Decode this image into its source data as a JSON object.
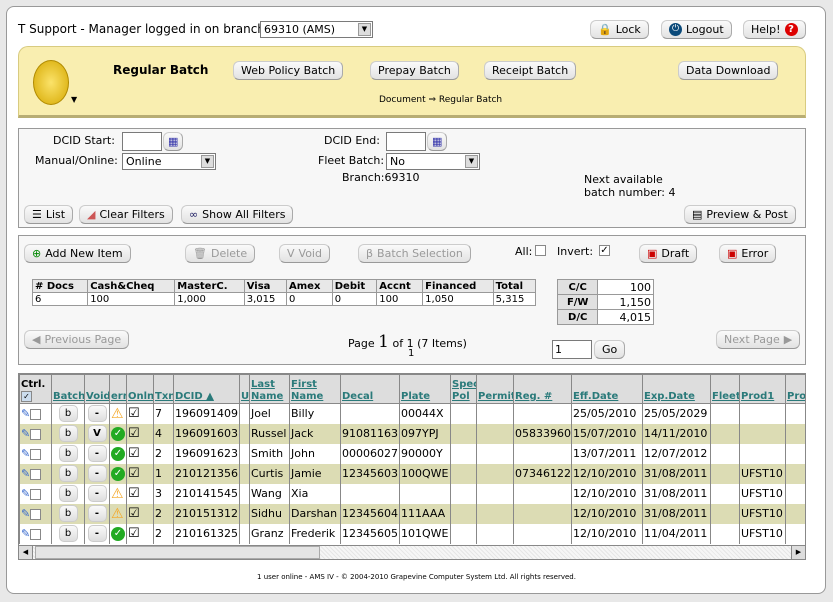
{
  "header": {
    "login_text": "T Support - Manager logged in on branch:",
    "branch_select": "69310 (AMS)",
    "lock": "Lock",
    "logout": "Logout",
    "help": "Help!"
  },
  "banner": {
    "active": "Regular Batch",
    "tabs": [
      "Web Policy Batch",
      "Prepay Batch",
      "Receipt Batch",
      "Data Download"
    ],
    "breadcrumb": "Document ⇒ Regular Batch"
  },
  "filters": {
    "dcid_start_label": "DCID Start:",
    "dcid_start": "",
    "dcid_end_label": "DCID End:",
    "dcid_end": "",
    "manual_online_label": "Manual/Online:",
    "manual_online": "Online",
    "fleet_batch_label": "Fleet Batch:",
    "fleet_batch": "No",
    "branch": "Branch:69310",
    "next_batch_1": "Next available",
    "next_batch_2": "batch number: 4",
    "list": "List",
    "clear": "Clear Filters",
    "show_all": "Show All Filters",
    "preview_post": "Preview & Post"
  },
  "actions": {
    "add": "Add New Item",
    "delete": "Delete",
    "void": "Void",
    "batch_selection": "Batch Selection",
    "all_label": "All:",
    "all_checked": false,
    "invert_label": "Invert:",
    "invert_checked": true,
    "draft": "Draft",
    "error": "Error"
  },
  "summary": {
    "headers": [
      "# Docs",
      "Cash&Cheq",
      "MasterC.",
      "Visa",
      "Amex",
      "Debit",
      "Accnt",
      "Financed",
      "Total"
    ],
    "values": [
      "6",
      "100",
      "1,000",
      "3,015",
      "0",
      "0",
      "100",
      "1,050",
      "5,315"
    ]
  },
  "card_totals": [
    {
      "k": "C/C",
      "v": "100"
    },
    {
      "k": "F/W",
      "v": "1,150"
    },
    {
      "k": "D/C",
      "v": "4,015"
    }
  ],
  "paging": {
    "prev": "Previous Page",
    "next": "Next Page",
    "page_prefix": "Page",
    "page_num": "1",
    "page_suffix": "of 1 (7 Items)",
    "page_links": "1",
    "goto_value": "1",
    "go": "Go"
  },
  "grid": {
    "columns": [
      "Ctrl.",
      "Batch",
      "Void",
      "err",
      "Onln",
      "Txn",
      "DCID ▲",
      "U",
      "Last Name",
      "First Name",
      "Decal",
      "Plate",
      "Spec Pol",
      "Permit",
      "Reg. #",
      "Eff.Date",
      "Exp.Date",
      "Fleet",
      "Prod1",
      "Prod"
    ],
    "rows": [
      {
        "batch": "b",
        "void": "-",
        "err": "warning",
        "txn": "7",
        "dcid": "196091409",
        "u": "",
        "last": "Joel",
        "first": "Billy",
        "decal": "",
        "plate": "00044X",
        "spec": "",
        "permit": "",
        "reg": "",
        "eff": "25/05/2010",
        "exp": "25/05/2029",
        "fleet": "",
        "prod1": "",
        "prod": ""
      },
      {
        "batch": "b",
        "void": "V",
        "err": "ok",
        "txn": "4",
        "dcid": "196091603",
        "u": "",
        "last": "Russel",
        "first": "Jack",
        "decal": "91081163",
        "plate": "097YPJ",
        "spec": "",
        "permit": "",
        "reg": "05833960",
        "eff": "15/07/2010",
        "exp": "14/11/2010",
        "fleet": "",
        "prod1": "",
        "prod": ""
      },
      {
        "batch": "b",
        "void": "-",
        "err": "ok",
        "txn": "2",
        "dcid": "196091623",
        "u": "",
        "last": "Smith",
        "first": "John",
        "decal": "00006027",
        "plate": "90000Y",
        "spec": "",
        "permit": "",
        "reg": "",
        "eff": "13/07/2011",
        "exp": "12/07/2012",
        "fleet": "",
        "prod1": "",
        "prod": ""
      },
      {
        "batch": "b",
        "void": "-",
        "err": "ok",
        "txn": "1",
        "dcid": "210121356",
        "u": "",
        "last": "Curtis",
        "first": "Jamie",
        "decal": "12345603",
        "plate": "100QWE",
        "spec": "",
        "permit": "",
        "reg": "07346122",
        "eff": "12/10/2010",
        "exp": "31/08/2011",
        "fleet": "",
        "prod1": "UFST10",
        "prod": ""
      },
      {
        "batch": "b",
        "void": "-",
        "err": "warning",
        "txn": "3",
        "dcid": "210141545",
        "u": "",
        "last": "Wang",
        "first": "Xia",
        "decal": "",
        "plate": "",
        "spec": "",
        "permit": "",
        "reg": "",
        "eff": "12/10/2010",
        "exp": "31/08/2011",
        "fleet": "",
        "prod1": "UFST10",
        "prod": ""
      },
      {
        "batch": "b",
        "void": "-",
        "err": "warning",
        "txn": "2",
        "dcid": "210151312",
        "u": "",
        "last": "Sidhu",
        "first": "Darshan",
        "decal": "12345604",
        "plate": "111AAA",
        "spec": "",
        "permit": "",
        "reg": "",
        "eff": "12/10/2010",
        "exp": "31/08/2011",
        "fleet": "",
        "prod1": "UFST10",
        "prod": ""
      },
      {
        "batch": "b",
        "void": "-",
        "err": "ok",
        "txn": "2",
        "dcid": "210161325",
        "u": "",
        "last": "Granz",
        "first": "Frederik",
        "decal": "12345605",
        "plate": "101QWE",
        "spec": "",
        "permit": "",
        "reg": "",
        "eff": "12/10/2010",
        "exp": "11/04/2011",
        "fleet": "",
        "prod1": "UFST10",
        "prod": ""
      }
    ]
  },
  "footer": "1 user online - AMS IV - © 2004-2010 Grapevine Computer System Ltd. All rights reserved.",
  "colors": {
    "banner": "#f9eeb0",
    "row_alt": "#dcdcb4",
    "header_link": "#2a7a7a",
    "ok": "#22aa22",
    "warning": "#f5a623"
  }
}
